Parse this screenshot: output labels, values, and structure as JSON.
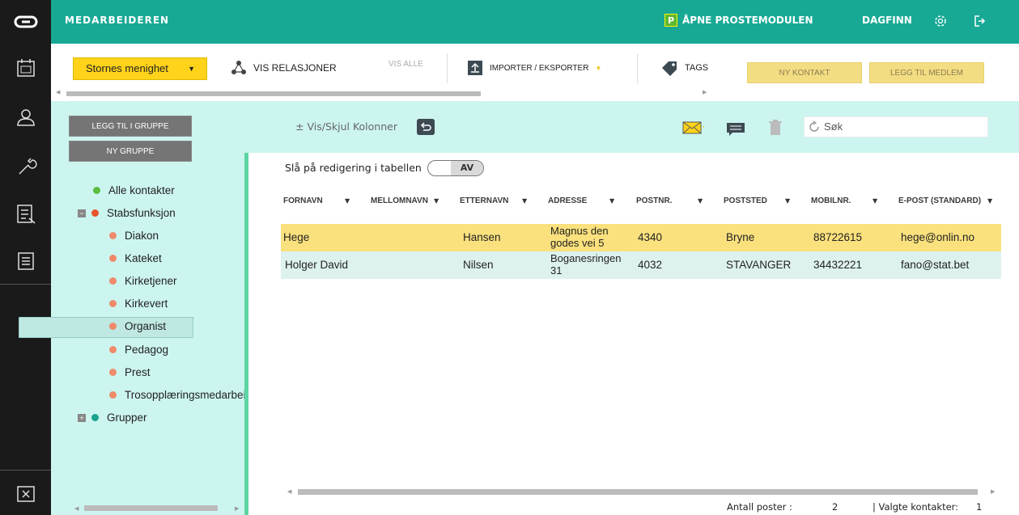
{
  "app": {
    "title": "MEDARBEIDEREN",
    "proste_label": "ÅPNE PROSTEMODULEN",
    "proste_badge": "P",
    "user": "DAGFINN"
  },
  "toolbar": {
    "church_select": "Stornes menighet",
    "vis_relasjoner": "VIS RELASJONER",
    "vis_alle": "VIS ALLE",
    "import_export": "IMPORTER / EKSPORTER",
    "tags": "TAGS",
    "ny_kontakt": "NY KONTAKT",
    "legg_til_medlem": "LEGG TIL MEDLEM"
  },
  "left": {
    "legg_til_gruppe": "LEGG TIL I GRUPPE",
    "ny_gruppe": "NY GRUPPE",
    "tree": {
      "alle": "Alle kontakter",
      "stabs": "Stabsfunksjon",
      "children": [
        "Diakon",
        "Kateket",
        "Kirketjener",
        "Kirkevert",
        "Organist",
        "Pedagog",
        "Prest",
        "Trosopplæringsmedarbeider"
      ],
      "grupper": "Grupper"
    }
  },
  "main": {
    "vis_skjul": "Vis/Skjul Kolonner",
    "search_placeholder": "Søk",
    "edit_label": "Slå på redigering i tabellen",
    "edit_toggle": "AV",
    "columns": [
      "FORNAVN",
      "MELLOMNAVN",
      "ETTERNAVN",
      "ADRESSE",
      "POSTNR.",
      "POSTSTED",
      "MOBILNR.",
      "E-POST (STANDARD)"
    ],
    "rows": [
      {
        "fornavn": "Hege",
        "mellomnavn": "",
        "etternavn": "Hansen",
        "adresse": "Magnus den godes vei 5",
        "postnr": "4340",
        "poststed": "Bryne",
        "mobil": "88722615",
        "epost": "hege@onlin.no"
      },
      {
        "fornavn": "Holger David",
        "mellomnavn": "",
        "etternavn": "Nilsen",
        "adresse": "Boganesringen 31",
        "postnr": "4032",
        "poststed": "STAVANGER",
        "mobil": "34432221",
        "epost": "fano@stat.bet"
      }
    ],
    "status": {
      "antall_label": "Antall poster :",
      "antall_value": "2",
      "valgte_label": "| Valgte kontakter:",
      "valgte_value": "1"
    }
  },
  "colors": {
    "teal": "#18a995",
    "yellow": "#ffd31a",
    "panel": "#ccf5f0",
    "selected_row": "#fae17d"
  }
}
